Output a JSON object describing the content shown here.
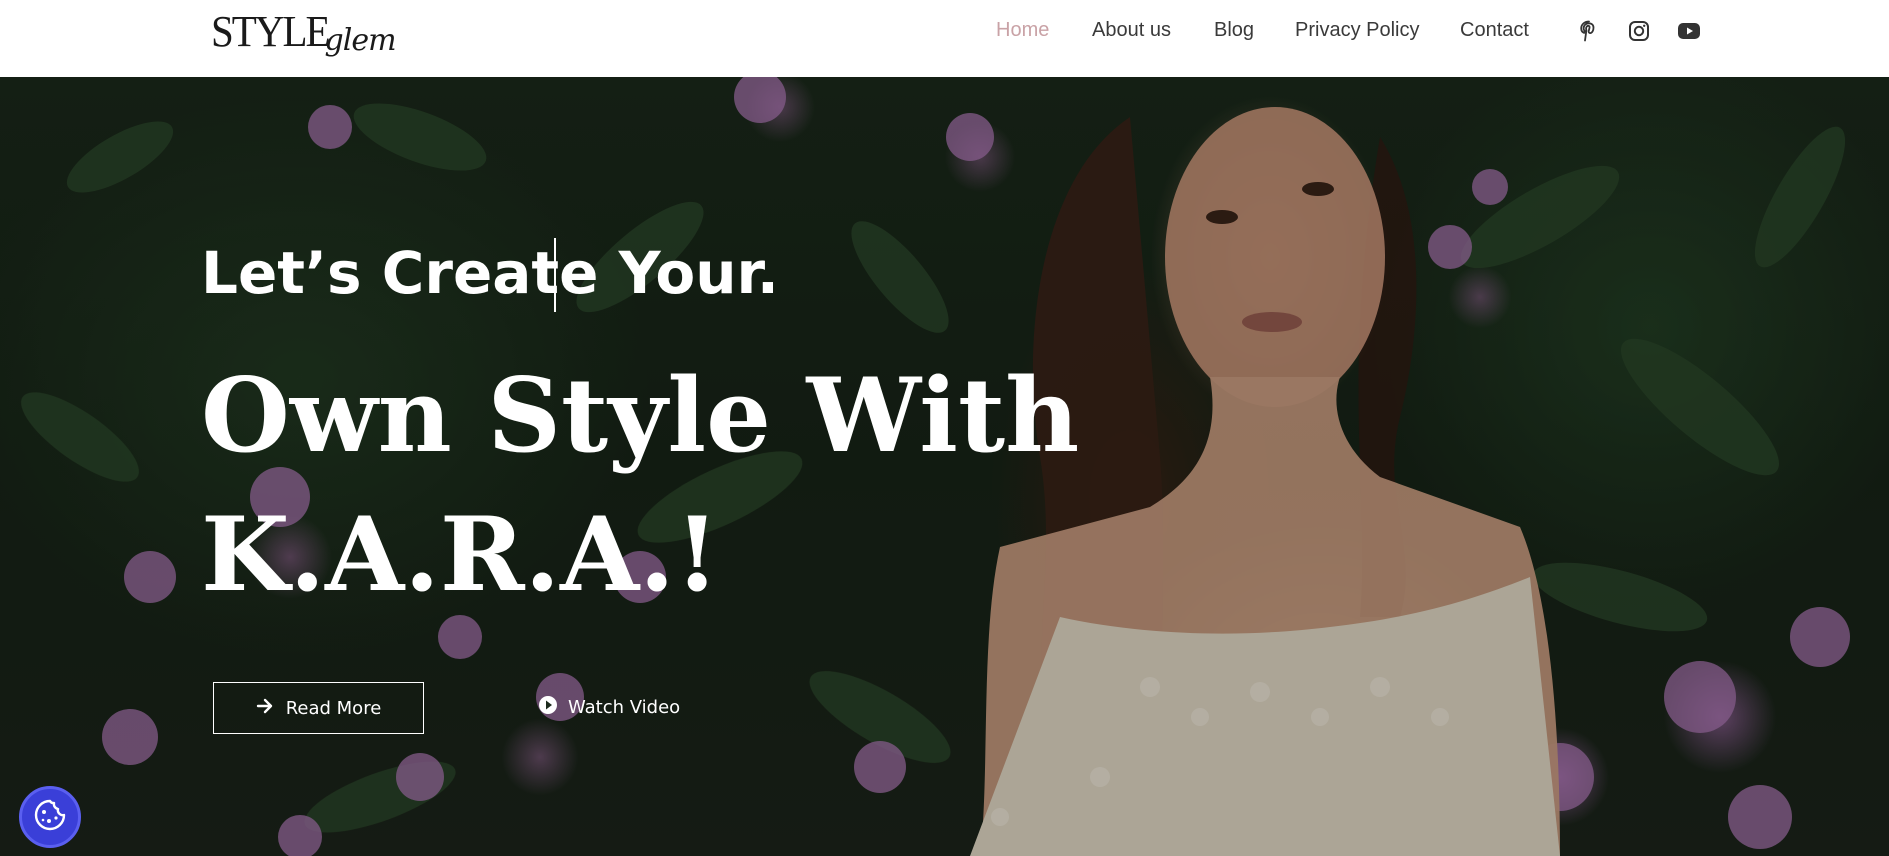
{
  "brand": {
    "logo_main": "STYLE",
    "logo_script": "glem"
  },
  "nav": {
    "items": [
      {
        "label": "Home",
        "active": true
      },
      {
        "label": "About us",
        "active": false
      },
      {
        "label": "Blog",
        "active": false
      },
      {
        "label": "Privacy Policy",
        "active": false
      },
      {
        "label": "Contact",
        "active": false
      }
    ],
    "active_color": "#c9a2a6",
    "social": [
      "pinterest-icon",
      "instagram-icon",
      "youtube-icon"
    ]
  },
  "hero": {
    "headline_small": "Let’s Create Your.",
    "headline_line1": "Own Style With",
    "headline_line2": "K.A.R.A.!",
    "read_more_label": "Read More",
    "watch_video_label": "Watch Video"
  },
  "cookie": {
    "icon": "cookie-icon",
    "color": "#3a3fd8"
  }
}
